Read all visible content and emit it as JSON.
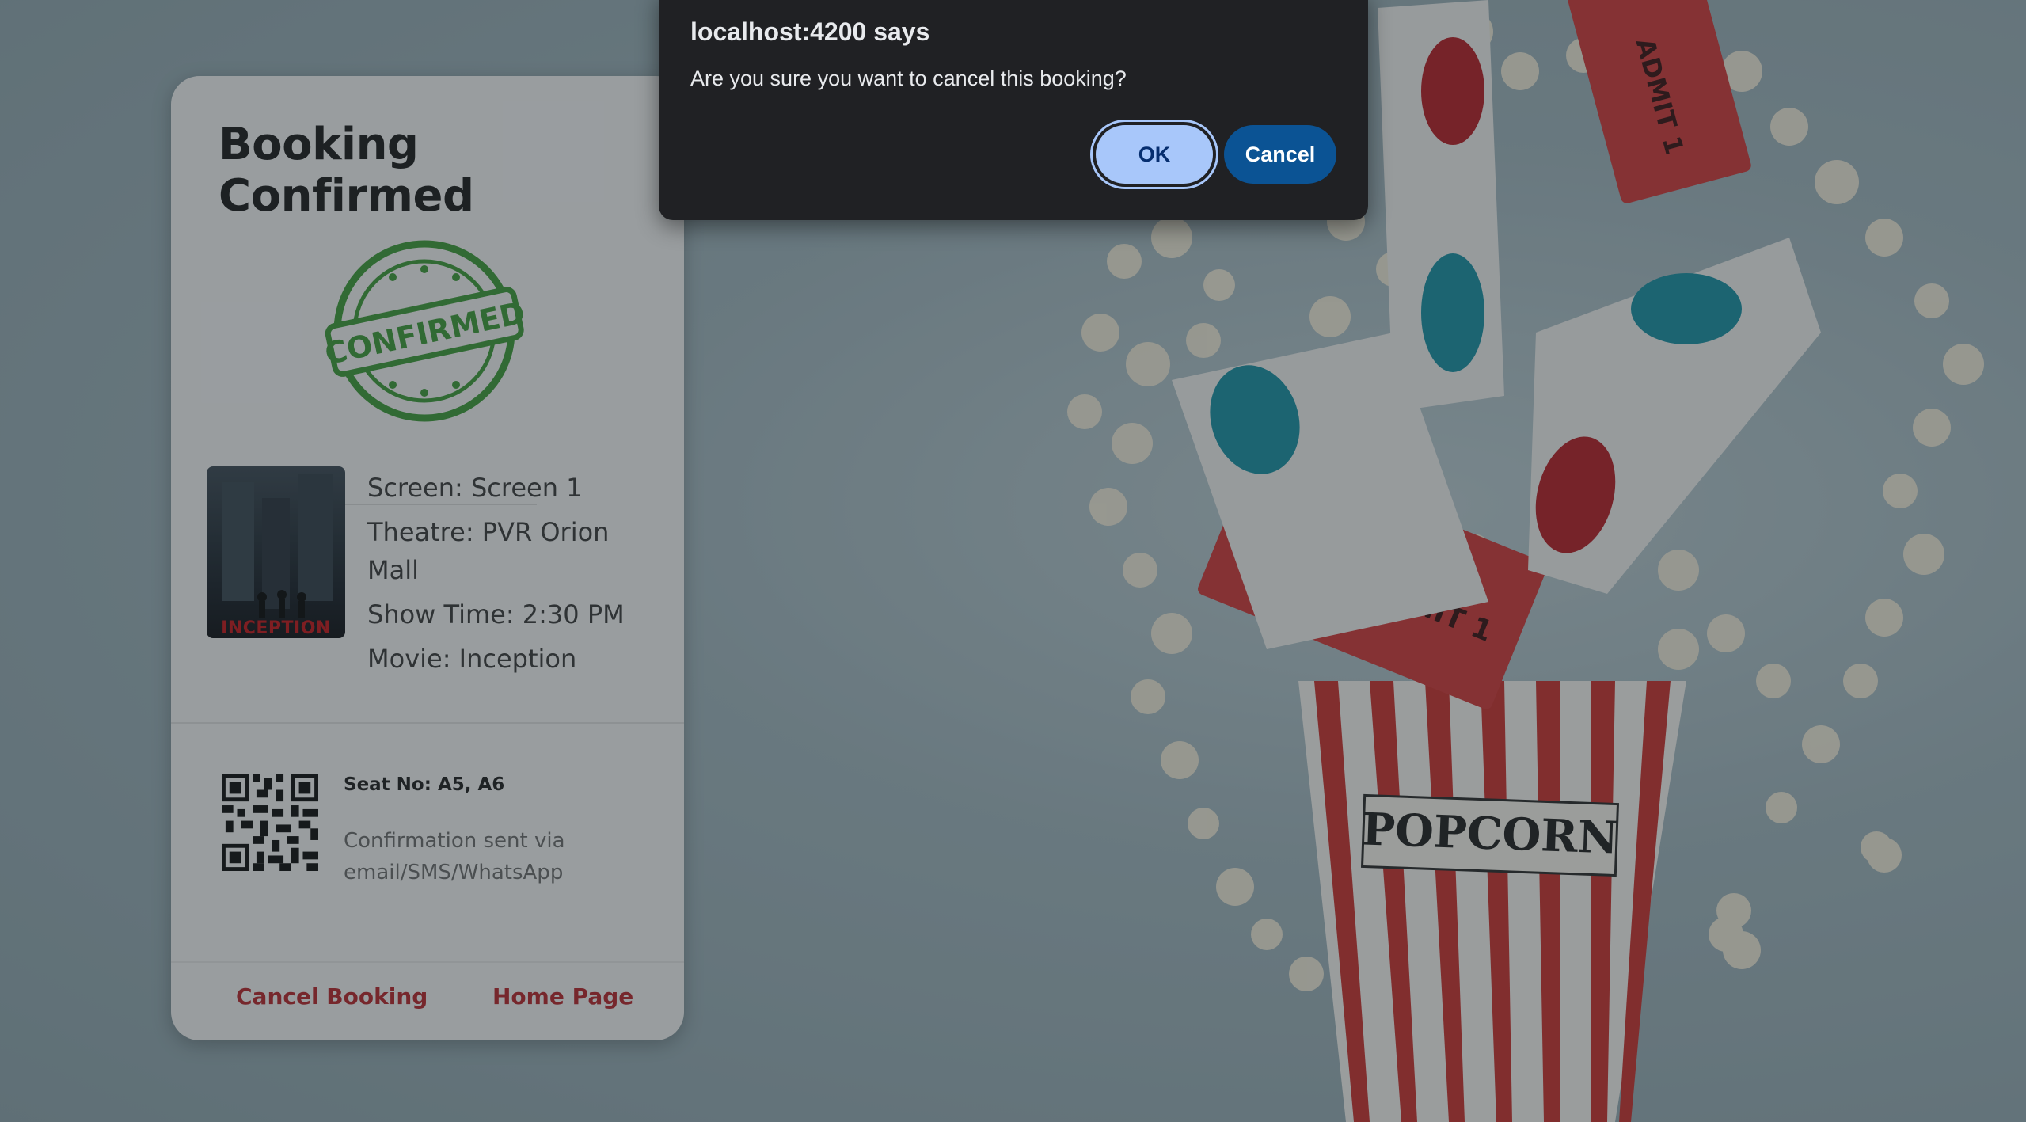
{
  "dialog": {
    "title": "localhost:4200 says",
    "message": "Are you sure you want to cancel this booking?",
    "ok_label": "OK",
    "cancel_label": "Cancel"
  },
  "card": {
    "title": "Booking Confirmed",
    "stamp_text": "CONFIRMED",
    "poster_title": "INCEPTION",
    "details": [
      "Screen: Screen 1",
      "Theatre: PVR Orion Mall",
      "Show Time: 2:30 PM",
      "Movie: Inception"
    ],
    "seat": "Seat No: A5, A6",
    "confirmation_note": "Confirmation sent via email/SMS/WhatsApp",
    "cancel_booking_label": "Cancel Booking",
    "home_page_label": "Home Page"
  },
  "background": {
    "popcorn_label": "POPCORN",
    "ticket_text": "ADMIT 1"
  },
  "colors": {
    "accent_red": "#b5262c",
    "stamp_green": "#3f9a3a",
    "dialog_bg": "#202124",
    "ok_button": "#a8c7fa",
    "cancel_button": "#0b5394"
  }
}
